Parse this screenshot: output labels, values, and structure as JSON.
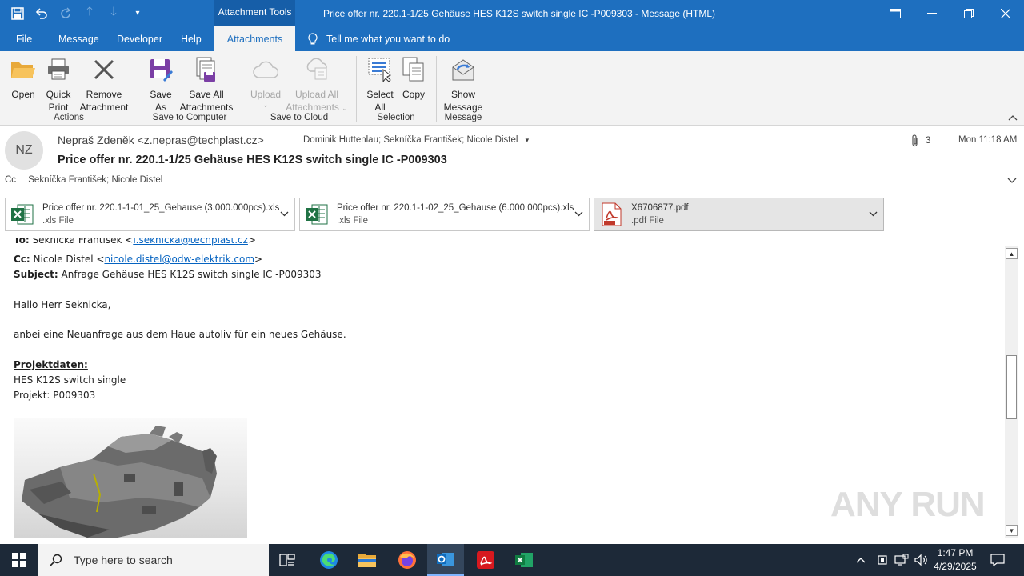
{
  "window": {
    "title": "Price offer nr. 220.1-1/25 Gehäuse HES K12S switch single IC -P009303  -  Message (HTML)",
    "context_tab": "Attachment Tools"
  },
  "tabs": [
    {
      "label": "File"
    },
    {
      "label": "Message"
    },
    {
      "label": "Developer"
    },
    {
      "label": "Help"
    },
    {
      "label": "Attachments"
    }
  ],
  "tell_me": "Tell me what you want to do",
  "ribbon": {
    "groups": [
      {
        "label": "Actions",
        "buttons": [
          "Open",
          "Quick Print",
          "Remove Attachment"
        ]
      },
      {
        "label": "Save to Computer",
        "buttons": [
          "Save As",
          "Save All Attachments"
        ]
      },
      {
        "label": "Save to Cloud",
        "buttons": [
          "Upload",
          "Upload All Attachments"
        ]
      },
      {
        "label": "Selection",
        "buttons": [
          "Select All",
          "Copy"
        ]
      },
      {
        "label": "Message",
        "buttons": [
          "Show Message"
        ]
      }
    ],
    "btn": {
      "open": "Open",
      "quick_print_1": "Quick",
      "quick_print_2": "Print",
      "remove_1": "Remove",
      "remove_2": "Attachment",
      "save_as_1": "Save",
      "save_as_2": "As",
      "save_all_1": "Save All",
      "save_all_2": "Attachments",
      "upload": "Upload",
      "upload_all_1": "Upload All",
      "upload_all_2": "Attachments",
      "select_all_1": "Select",
      "select_all_2": "All",
      "copy": "Copy",
      "show_msg_1": "Show",
      "show_msg_2": "Message"
    },
    "group_labels": {
      "actions": "Actions",
      "save_to_computer": "Save to Computer",
      "save_to_cloud": "Save to Cloud",
      "selection": "Selection",
      "message": "Message"
    }
  },
  "header": {
    "avatar_initials": "NZ",
    "from": "Nepraš Zdeněk <z.nepras@techplast.cz>",
    "to": "Dominik Huttenlau; Sekníčka František; Nicole Distel",
    "subject": "Price offer nr. 220.1-1/25 Gehäuse HES K12S switch single IC -P009303",
    "cc_label": "Cc",
    "cc": "Sekníčka František; Nicole Distel",
    "attachment_count": "3",
    "date": "Mon 11:18 AM"
  },
  "attachments": [
    {
      "name": "Price offer nr. 220.1-1-01_25_Gehause (3.000.000pcs).xls",
      "type": ".xls File",
      "icon": "excel-icon"
    },
    {
      "name": "Price offer nr. 220.1-1-02_25_Gehause (6.000.000pcs).xls",
      "type": ".xls File",
      "icon": "excel-icon"
    },
    {
      "name": "X6706877.pdf",
      "type": ".pdf File",
      "icon": "pdf-icon"
    }
  ],
  "body": {
    "to_partial_label": "To:",
    "to_partial_name": "Sekníčka František <",
    "to_partial_email": "f.seknicka@techplast.cz",
    "to_partial_close": ">",
    "cc_label": "Cc:",
    "cc_name": "Nicole Distel <",
    "cc_email": "nicole.distel@odw-elektrik.com",
    "cc_close": ">",
    "subject_label": "Subject:",
    "subject_text": "Anfrage Gehäuse HES K12S switch single IC -P009303",
    "greeting": "Hallo Herr Seknicka,",
    "intro": "anbei eine Neuanfrage aus dem Haue autoliv für ein neues Gehäuse.",
    "project_heading": "Projektdaten:",
    "project_line1": "HES K12S switch single",
    "project_line2": "Projekt: P009303"
  },
  "watermark": "ANY RUN",
  "taskbar": {
    "search_placeholder": "Type here to search",
    "time": "1:47 PM",
    "date": "4/29/2025"
  },
  "colors": {
    "title_blue": "#1e6fbf",
    "link": "#0563c1",
    "taskbar": "#1d2938"
  }
}
